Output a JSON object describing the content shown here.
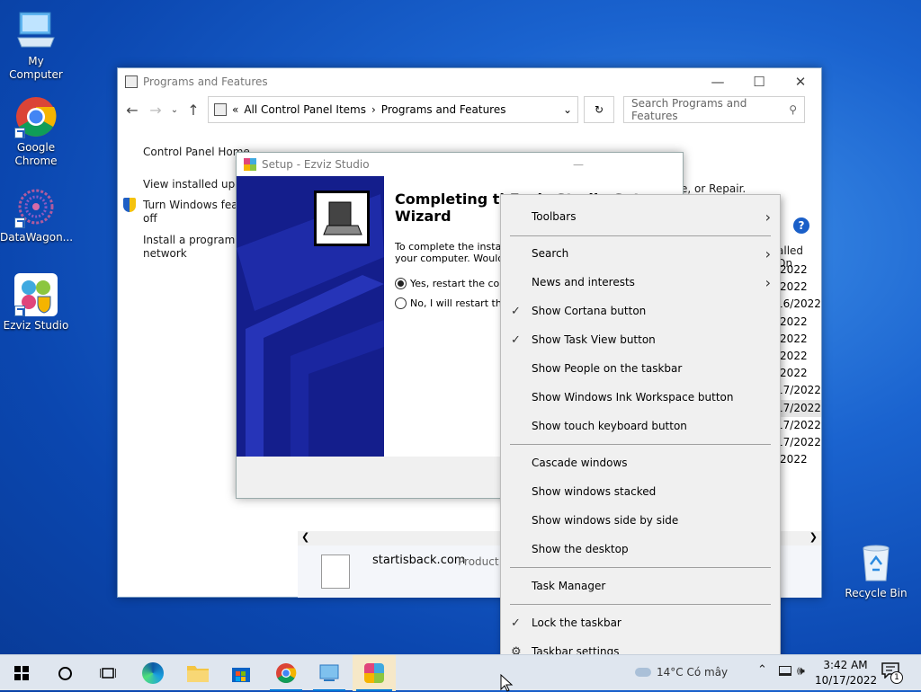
{
  "desktop": {
    "icons": [
      {
        "label": "My Computer"
      },
      {
        "label": "Google Chrome"
      },
      {
        "label": "DataWagon..."
      },
      {
        "label": "Ezviz Studio"
      },
      {
        "label": "Recycle Bin"
      }
    ]
  },
  "programs_window": {
    "title": "Programs and Features",
    "breadcrumb": [
      "All Control Panel Items",
      "Programs and Features"
    ],
    "search_placeholder": "Search Programs and Features",
    "sidebar": {
      "home": "Control Panel Home",
      "updates": "View installed updat",
      "features": "Turn Windows featu",
      "features2": "off",
      "install": "Install a program fro",
      "install2": "network"
    },
    "repair_text": "e, or Repair.",
    "col_header": "alled On",
    "dates": [
      "/2022",
      "/2022",
      "16/2022",
      "/2022",
      "/2022",
      "/2022",
      "/2022",
      "17/2022",
      "17/2022",
      "17/2022",
      "17/2022",
      "/2022"
    ],
    "details": {
      "name": "startisback.com",
      "label": "Product v"
    }
  },
  "setup_dialog": {
    "title": "Setup - Ezviz Studio",
    "heading": "Completing th",
    "heading_tail": "Ezviz Studio Set",
    "heading2": "Wizard",
    "body1": "To complete the installati",
    "body2": "your computer. Would yo",
    "option_yes": "Yes, restart the comp",
    "option_no": "No, I will restart the c"
  },
  "context_menu": {
    "items": [
      {
        "label": "Toolbars",
        "checked": false,
        "submenu": true
      },
      {
        "label": "Search",
        "checked": false,
        "submenu": true
      },
      {
        "label": "News and interests",
        "checked": false,
        "submenu": true
      },
      {
        "label": "Show Cortana button",
        "checked": true,
        "submenu": false
      },
      {
        "label": "Show Task View button",
        "checked": true,
        "submenu": false
      },
      {
        "label": "Show People on the taskbar",
        "checked": false,
        "submenu": false
      },
      {
        "label": "Show Windows Ink Workspace button",
        "checked": false,
        "submenu": false
      },
      {
        "label": "Show touch keyboard button",
        "checked": false,
        "submenu": false
      },
      {
        "label": "Cascade windows",
        "checked": false,
        "submenu": false
      },
      {
        "label": "Show windows stacked",
        "checked": false,
        "submenu": false
      },
      {
        "label": "Show windows side by side",
        "checked": false,
        "submenu": false
      },
      {
        "label": "Show the desktop",
        "checked": false,
        "submenu": false
      },
      {
        "label": "Task Manager",
        "checked": false,
        "submenu": false
      },
      {
        "label": "Lock the taskbar",
        "checked": true,
        "submenu": false
      },
      {
        "label": "Taskbar settings",
        "checked": false,
        "submenu": false
      }
    ]
  },
  "taskbar": {
    "weather": "14°C  Có mây",
    "time": "3:42 AM",
    "date": "10/17/2022",
    "notification_count": "1"
  },
  "colors": {
    "accent": "#0078d7",
    "desktop": "#0b47b0",
    "taskbar": "#dfe6ef",
    "menu": "#f0f0f0"
  }
}
